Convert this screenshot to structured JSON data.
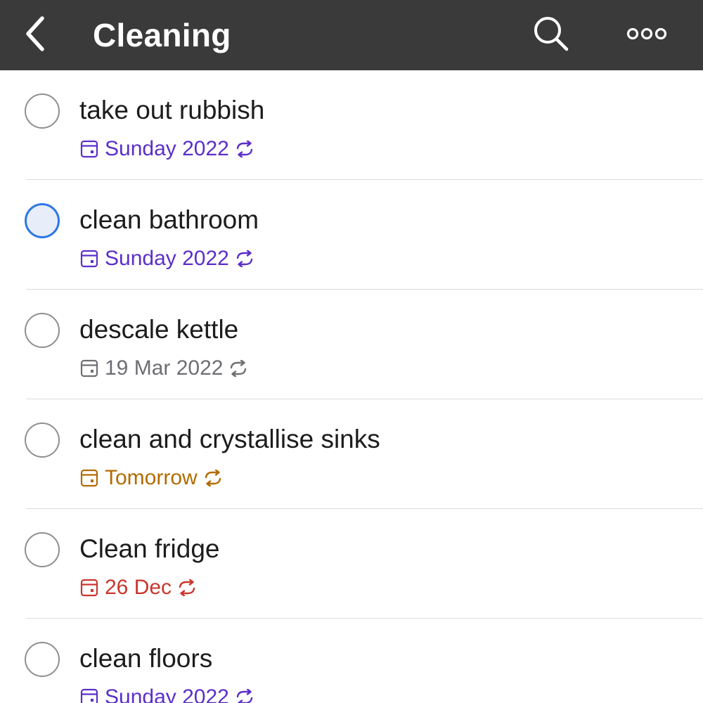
{
  "header": {
    "title": "Cleaning",
    "back_icon": "chevron-left-icon",
    "search_icon": "search-icon",
    "more_icon": "more-options-icon"
  },
  "colors": {
    "header_bg": "#3a3a3a",
    "purple": "#5b2fc9",
    "gray": "#6e6e73",
    "orange": "#b36b00",
    "red": "#c8372d",
    "selected_ring": "#2f78e4"
  },
  "tasks": [
    {
      "title": "take out rubbish",
      "due": "Sunday 2022",
      "color": "#5b2fc9",
      "selected": false
    },
    {
      "title": "clean bathroom",
      "due": "Sunday 2022",
      "color": "#5b2fc9",
      "selected": true
    },
    {
      "title": "descale kettle",
      "due": "19 Mar 2022",
      "color": "#6e6e73",
      "selected": false
    },
    {
      "title": "clean and crystallise sinks",
      "due": "Tomorrow",
      "color": "#b36b00",
      "selected": false
    },
    {
      "title": "Clean fridge",
      "due": "26 Dec",
      "color": "#c8372d",
      "selected": false
    },
    {
      "title": "clean floors",
      "due": "Sunday 2022",
      "color": "#5b2fc9",
      "selected": false
    }
  ]
}
